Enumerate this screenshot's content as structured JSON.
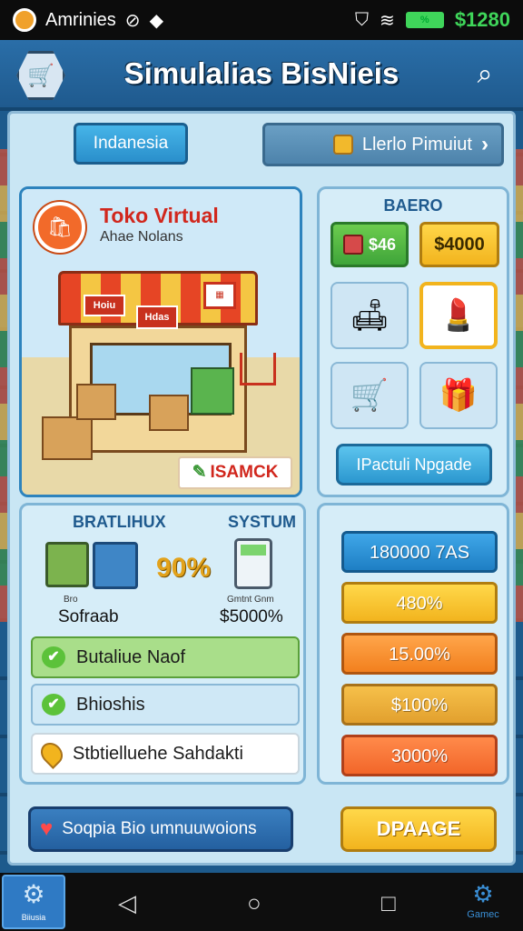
{
  "status_bar": {
    "app_name": "Amrinies",
    "battery_label": "%",
    "balance": "$1280"
  },
  "header": {
    "title": "Simulalias BisNieis"
  },
  "top_row": {
    "region": "Indanesia",
    "goals_label": "Llerlo Pimuiut"
  },
  "shop": {
    "name": "Toko Virtual",
    "subtitle": "Ahae Nolans",
    "sign_a": "Hoiu",
    "sign_b": "Hdas",
    "restock_label": "ISAMCK"
  },
  "inventory": {
    "title": "BAERO",
    "count_value": "$46",
    "cash_value": "$4000",
    "slots": [
      "sofa-icon",
      "cosmetics-icon",
      "cart-icon",
      "gift-icon"
    ],
    "upgrade_label": "IPactuli Npgade"
  },
  "system": {
    "left_heading": "BRATLIHUX",
    "right_heading": "SYSTUM",
    "percent": "90%",
    "left_small": "Bro",
    "left_value": "Sofraab",
    "right_small": "Gmtnt Gnm",
    "right_value": "$5000%",
    "tasks": [
      {
        "label": "Butaliue Naof",
        "icon": "check-icon"
      },
      {
        "label": "Bhioshis",
        "icon": "check-icon"
      },
      {
        "label": "Stbtielluehe Sahdakti",
        "icon": "pin-icon"
      }
    ]
  },
  "stats": {
    "bars": [
      "180000 7AS",
      "480%",
      "15.00%",
      "$100%",
      "3000%"
    ]
  },
  "actions": {
    "social_label": "Soqpia Bio umnuuwoions",
    "upgrade_label": "DPAAGE"
  },
  "navbar": {
    "home_label": "Biiusia",
    "settings_label": "Gamec"
  },
  "colors": {
    "header": "#2a6ea8",
    "panel": "#c9e6f4",
    "accent_gold": "#f2b41e",
    "accent_blue": "#2b97cf",
    "accent_green": "#5cc23a"
  }
}
